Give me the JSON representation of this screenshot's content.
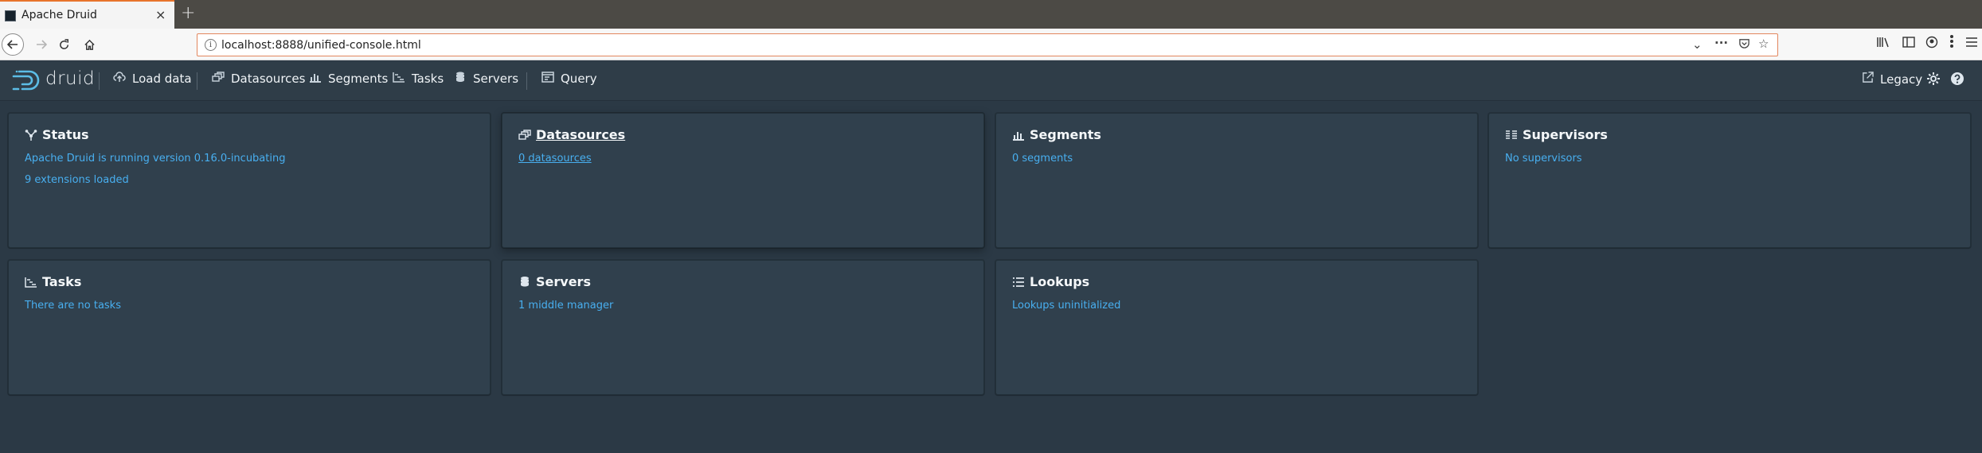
{
  "browser": {
    "tab_title": "Apache Druid",
    "tab_close": "×",
    "new_tab": "+",
    "url": "localhost:8888/unified-console.html"
  },
  "header": {
    "logo_text": "druid",
    "nav": {
      "load_data": "Load data",
      "datasources": "Datasources",
      "segments": "Segments",
      "tasks": "Tasks",
      "servers": "Servers",
      "query": "Query"
    },
    "legacy": "Legacy"
  },
  "cards": {
    "status": {
      "title": "Status",
      "line1": "Apache Druid is running version 0.16.0-incubating",
      "line2": "9 extensions loaded"
    },
    "datasources": {
      "title": "Datasources",
      "line1": "0 datasources"
    },
    "segments": {
      "title": "Segments",
      "line1": "0 segments"
    },
    "supervisors": {
      "title": "Supervisors",
      "line1": "No supervisors"
    },
    "tasks": {
      "title": "Tasks",
      "line1": "There are no tasks"
    },
    "servers": {
      "title": "Servers",
      "line1": "1 middle manager"
    },
    "lookups": {
      "title": "Lookups",
      "line1": "Lookups uninitialized"
    }
  },
  "colors": {
    "accent_link": "#48aff0",
    "page_bg": "#2b3945",
    "card_bg": "#30404d",
    "tab_accent": "#e8742c"
  }
}
